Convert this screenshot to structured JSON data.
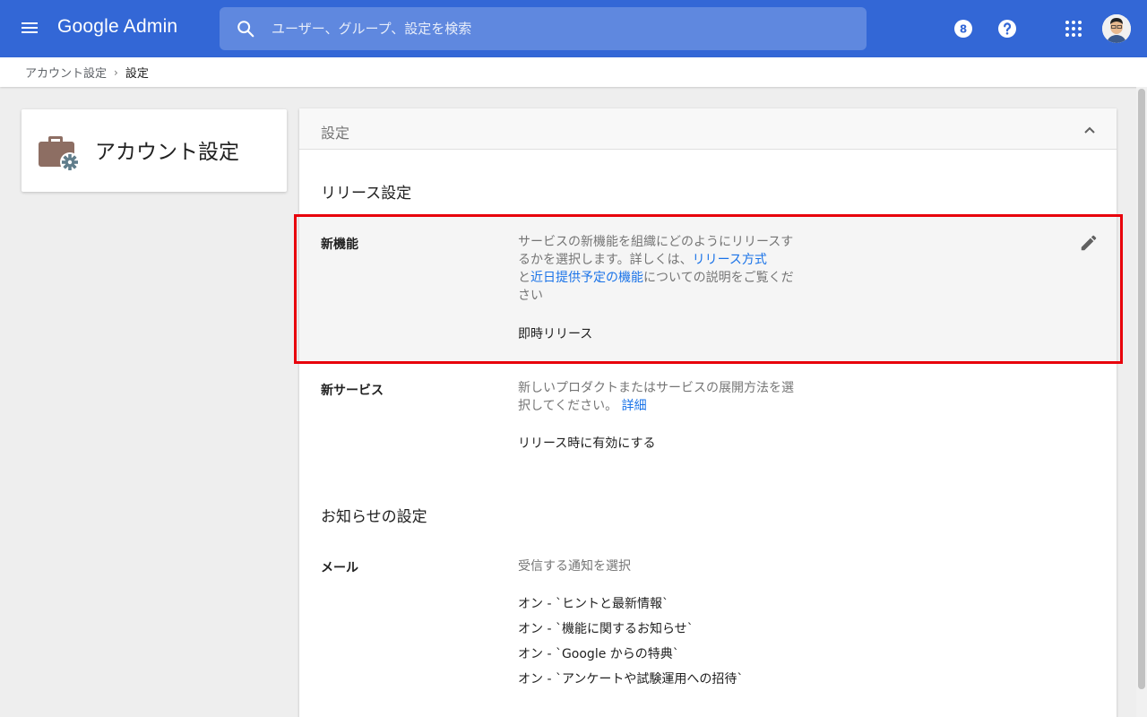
{
  "header": {
    "brand": "Google Admin",
    "search_placeholder": "ユーザー、グループ、設定を検索",
    "notification_count": "8"
  },
  "breadcrumb": {
    "parent": "アカウント設定",
    "current": "設定"
  },
  "left_card": {
    "title": "アカウント設定"
  },
  "panel": {
    "header_title": "設定",
    "release_section": {
      "title": "リリース設定",
      "new_features": {
        "label": "新機能",
        "desc_part1": "サービスの新機能を組織にどのようにリリースするかを選択します。詳しくは、",
        "link1": "リリース方式",
        "desc_part2": "と",
        "link2": "近日提供予定の機能",
        "desc_part3": "についての説明をご覧ください",
        "value": "即時リリース"
      },
      "new_services": {
        "label": "新サービス",
        "desc": "新しいプロダクトまたはサービスの展開方法を選択してください。",
        "link": "詳細",
        "value": "リリース時に有効にする"
      }
    },
    "notification_section": {
      "title": "お知らせの設定",
      "mail": {
        "label": "メール",
        "desc": "受信する通知を選択",
        "items": [
          "オン - `ヒントと最新情報`",
          "オン - `機能に関するお知らせ`",
          "オン - `Google からの特典`",
          "オン - `アンケートや試験運用への招待`"
        ]
      }
    }
  },
  "colors": {
    "topbar": "#3367d6",
    "link": "#1a73e8",
    "highlight_border": "#e8000b"
  }
}
